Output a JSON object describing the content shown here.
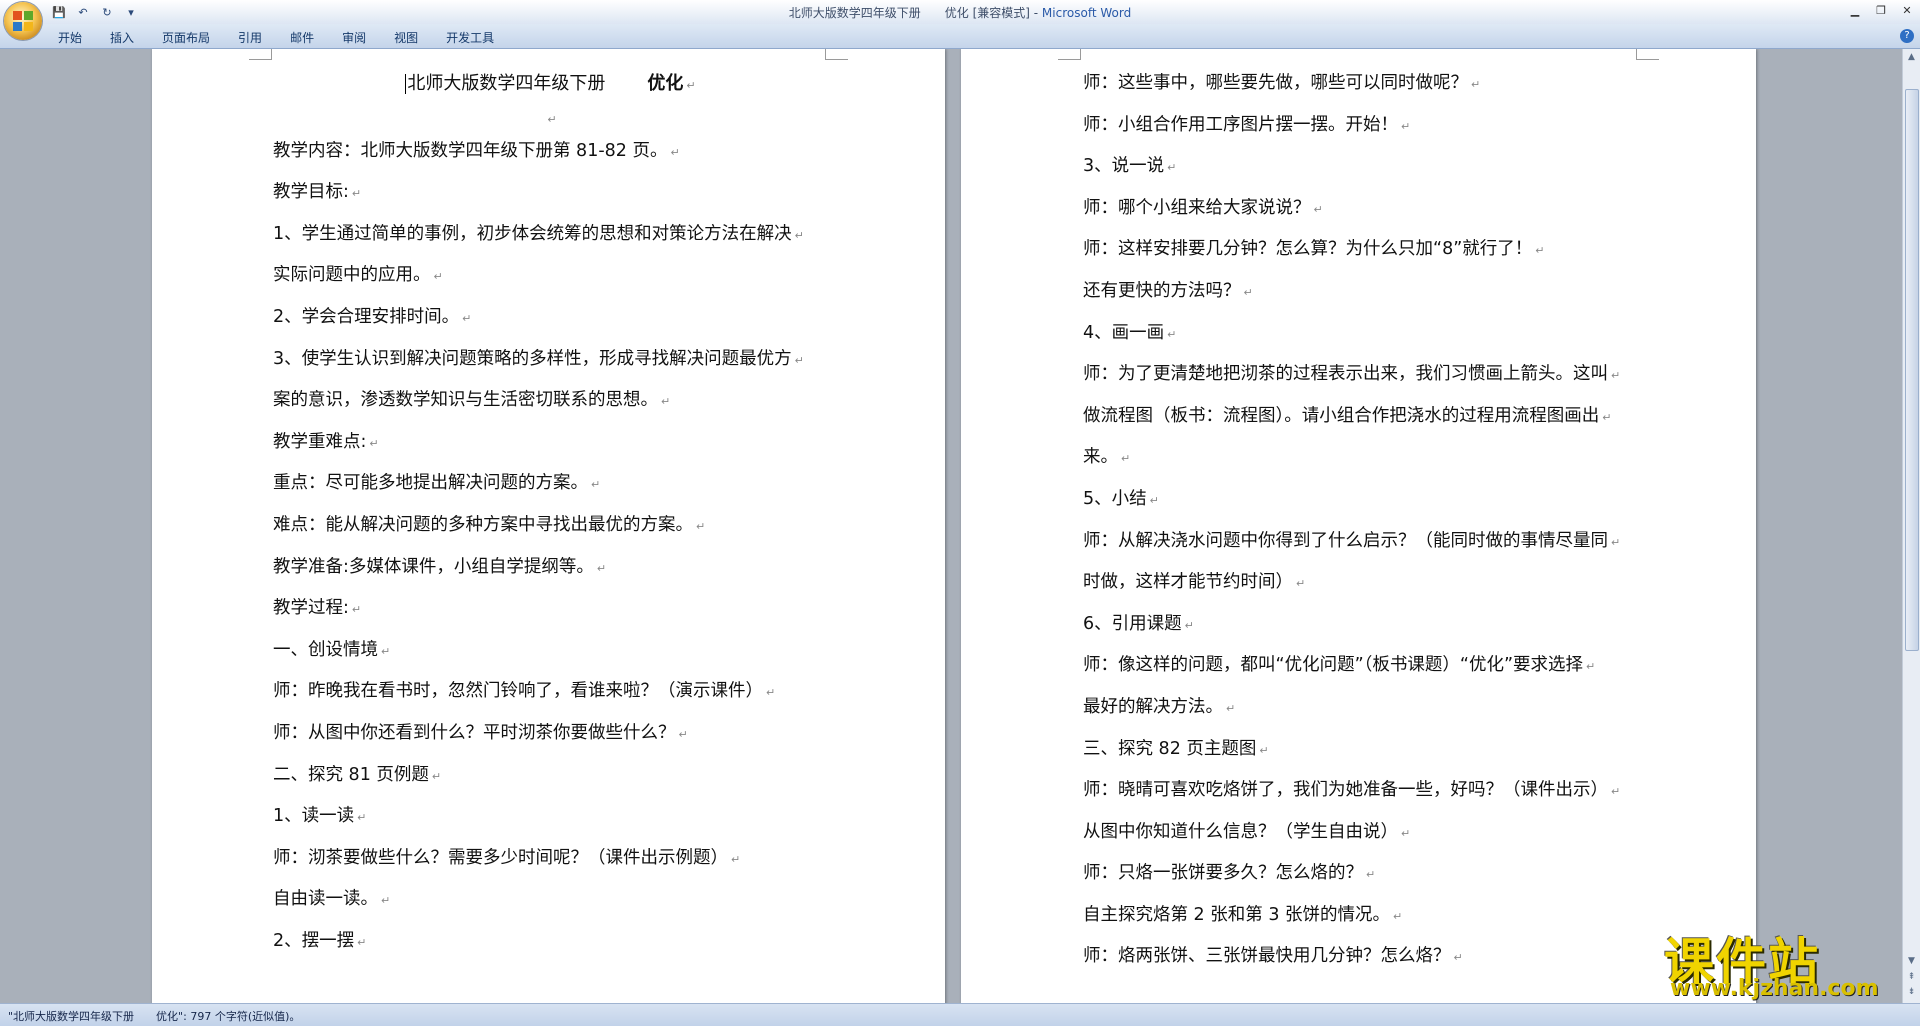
{
  "window": {
    "title": "北师大版数学四年级下册　　优化 [兼容模式] - ",
    "app_name": "Microsoft Word",
    "controls": [
      "minimize-icon",
      "restore-icon",
      "close-icon"
    ]
  },
  "quick_access": {
    "items": [
      {
        "name": "save-icon",
        "glyph": "💾"
      },
      {
        "name": "undo-icon",
        "glyph": "↶"
      },
      {
        "name": "redo-icon",
        "glyph": "↻"
      },
      {
        "name": "customize-icon",
        "glyph": "▾"
      }
    ]
  },
  "ribbon": {
    "tabs": [
      "开始",
      "插入",
      "页面布局",
      "引用",
      "邮件",
      "审阅",
      "视图",
      "开发工具"
    ],
    "help": "?"
  },
  "document": {
    "left_page": {
      "title_main": "北师大版数学四年级下册",
      "title_topic": "优化",
      "lines": [
        "",
        "教学内容：北师大版数学四年级下册第 81-82 页。",
        "教学目标:",
        "1、学生通过简单的事例，初步体会统筹的思想和对策论方法在解决",
        "实际问题中的应用。",
        "2、学会合理安排时间。",
        "3、使学生认识到解决问题策略的多样性，形成寻找解决问题最优方",
        "案的意识，渗透数学知识与生活密切联系的思想。",
        "教学重难点:",
        "重点：尽可能多地提出解决问题的方案。",
        "难点：能从解决问题的多种方案中寻找出最优的方案。",
        "教学准备:多媒体课件，小组自学提纲等。",
        "教学过程:",
        "一、创设情境",
        "师：昨晚我在看书时，忽然门铃响了，看谁来啦？（演示课件）",
        "师：从图中你还看到什么？平时沏茶你要做些什么？",
        "二、探究 81 页例题",
        "1、读一读",
        "师：沏茶要做些什么？需要多少时间呢？（课件出示例题）",
        "自由读一读。",
        "2、摆一摆"
      ]
    },
    "right_page": {
      "lines": [
        "师：这些事中，哪些要先做，哪些可以同时做呢？",
        "师：小组合作用工序图片摆一摆。开始！",
        "3、说一说",
        "师：哪个小组来给大家说说？",
        "师：这样安排要几分钟？怎么算？为什么只加“8”就行了！",
        "还有更快的方法吗？",
        "4、画一画",
        "师：为了更清楚地把沏茶的过程表示出来，我们习惯画上箭头。这叫",
        "做流程图（板书：流程图）。请小组合作把浇水的过程用流程图画出",
        "来。",
        "5、小结",
        "师：从解决浇水问题中你得到了什么启示？（能同时做的事情尽量同",
        "时做，这样才能节约时间）",
        "6、引用课题",
        "师：像这样的问题，都叫“优化问题”（板书课题）“优化”要求选择",
        "最好的解决方法。",
        "三、探究 82 页主题图",
        "师：晓晴可喜欢吃烙饼了，我们为她准备一些，好吗？（课件出示）",
        "从图中你知道什么信息？（学生自由说）",
        "师：只烙一张饼要多久？怎么烙的？",
        "自主探究烙第 2 张和第 3 张饼的情况。",
        "师：烙两张饼、三张饼最快用几分钟？怎么烙？"
      ]
    },
    "paragraph_mark": "↵"
  },
  "status_bar": {
    "text": "\"北师大版数学四年级下册　　优化\": 797 个字符(近似值)。"
  },
  "watermark": {
    "title": "课件站",
    "url": "www.kjzhan.com"
  },
  "colors": {
    "title_bar": "#dde6f3",
    "ribbon_tab_bg": "#c4d4ea",
    "workspace": "#a9b0ba",
    "watermark": "#f0d400"
  }
}
